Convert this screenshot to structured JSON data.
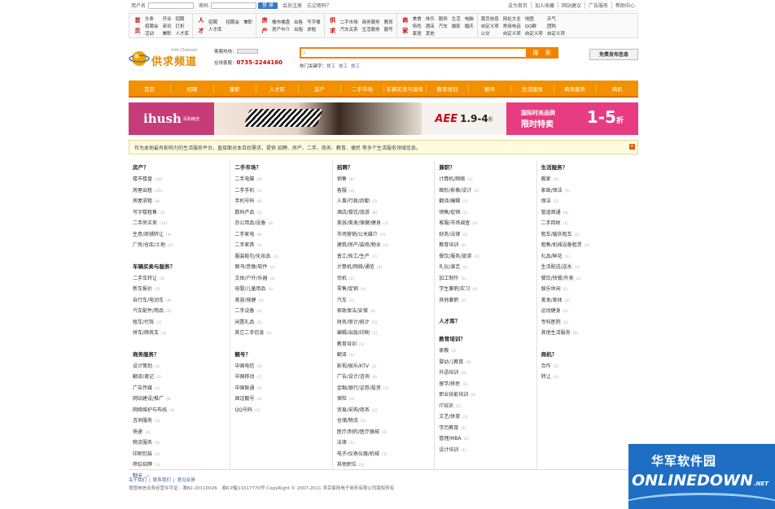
{
  "topbar": {
    "user_label": "用户名",
    "pwd_label": "密码",
    "login": "登 录",
    "register": "会员注册",
    "forgot": "忘记密码？",
    "right": [
      "设为首页",
      "加入收藏",
      "网站建议",
      "广告服务",
      "帮助中心"
    ]
  },
  "cat_groups": [
    {
      "title": [
        "首",
        "页"
      ],
      "cols": 3,
      "links": [
        "头条",
        "开业",
        "招聘",
        "招聘会",
        "商讯",
        "打折",
        "活动",
        "兼职",
        "人才库"
      ]
    },
    {
      "title": [
        "人",
        "才"
      ],
      "cols": 3,
      "links": [
        "招聘",
        "招聘会",
        "兼职",
        "人才库"
      ]
    },
    {
      "title": [
        "房",
        "产"
      ],
      "cols": 3,
      "links": [
        "楼市楼盘",
        "出售",
        "写字楼",
        "房产中介",
        "出租",
        "求租"
      ]
    },
    {
      "title": [
        "供",
        "求"
      ],
      "cols": 3,
      "links": [
        "二手市场",
        "商务服务",
        "教育",
        "汽车买卖",
        "生活服务",
        "靓号"
      ]
    },
    {
      "title": [
        "商",
        "家"
      ],
      "cols": 5,
      "links": [
        "美食",
        "休乐",
        "服饰",
        "生活",
        "电脑",
        "特色",
        "酒店",
        "汽车",
        "摄影",
        "婚庆",
        "家居",
        "其他"
      ]
    },
    {
      "title": [
        "",
        ""
      ],
      "cols": 4,
      "links": [
        "黄页信息",
        "网址大全",
        "地图",
        "天气",
        "自定义项",
        "常用电话",
        "QQ群",
        "团购",
        "公交",
        "自定义项",
        "自定义项",
        "自定义项"
      ]
    }
  ],
  "header": {
    "logo_en": "Info Channel",
    "logo_cn": "供求频道",
    "hotline_label": "客服热线：",
    "online_label": "在线客服：",
    "phone": "0735-2244160",
    "search_btn": "搜 索",
    "hot_label": "热门关键字：",
    "hot_words": [
      "技工",
      "技工",
      "技工"
    ],
    "publish": "免费发布信息"
  },
  "nav": [
    "首页",
    "招聘",
    "兼职",
    "人才库",
    "房产",
    "二手市场",
    "车辆买卖与服务",
    "教育培训",
    "靓号",
    "生活服务",
    "商务服务",
    "商机"
  ],
  "banner": {
    "b1": "ihush",
    "b1_small": "百购精选",
    "b3_brand": "AEE",
    "b3_disc": "1.9-4",
    "b3_unit": "折",
    "b4_line1": "国际时尚品牌",
    "b4_line2": "限时特卖",
    "b4_big": "1-5",
    "b4_unit": "折"
  },
  "notice": "作为本地最有影响力的生活服务平台，直接面对本百姓需求，提供 招聘、房产、二手、商务、教育、便民 等多个生活服务领域信息。",
  "columns": [
    [
      {
        "title": "房产？",
        "items": [
          [
            "楼市楼盘",
            "10"
          ],
          [
            "房屋出租",
            "25"
          ],
          [
            "房屋求租",
            "8"
          ],
          [
            "写字楼租售",
            "3"
          ],
          [
            "二手房买卖",
            "12"
          ],
          [
            "生意/商铺转让",
            "4"
          ],
          [
            "厂房/仓库/土地",
            "2"
          ]
        ]
      },
      {
        "title": "车辆买卖与服务？",
        "items": [
          [
            "二手车转让",
            "5"
          ],
          [
            "新车报价",
            "3"
          ],
          [
            "自行车/电动车",
            "6"
          ],
          [
            "汽车配件/用品",
            "2"
          ],
          [
            "租车/代驾",
            "1"
          ],
          [
            "拼车/顺风车",
            "3"
          ]
        ]
      },
      {
        "title": "商务服务？",
        "items": [
          [
            "设计策划",
            "4"
          ],
          [
            "翻译/速记",
            "1"
          ],
          [
            "广告传媒",
            "2"
          ],
          [
            "网站建设/推广",
            "6"
          ],
          [
            "网络维护与布线",
            "3"
          ],
          [
            "咨询服务",
            "1"
          ],
          [
            "快递",
            "2"
          ],
          [
            "物流服务",
            "5"
          ],
          [
            "印刷包装",
            "3"
          ],
          [
            "喷绘招牌",
            "1"
          ],
          [
            "制卡",
            "2"
          ]
        ]
      }
    ],
    [
      {
        "title": "二手市场？",
        "items": [
          [
            "二手电脑",
            "3"
          ],
          [
            "二手手机",
            "5"
          ],
          [
            "手机号码",
            "8"
          ],
          [
            "数码产品",
            "2"
          ],
          [
            "办公用品/设备",
            "4"
          ],
          [
            "二手家电",
            "6"
          ],
          [
            "二手家具",
            "3"
          ],
          [
            "服装鞋包/化妆品",
            "1"
          ],
          [
            "图书/音像/软件",
            "2"
          ],
          [
            "文体/户外/乐器",
            "4"
          ],
          [
            "母婴/儿童用品",
            "1"
          ],
          [
            "美容/保健",
            "3"
          ],
          [
            "二手设备",
            "2"
          ],
          [
            "闲置礼品",
            "5"
          ],
          [
            "其它二手信息",
            "1"
          ]
        ]
      },
      {
        "title": "靓号？",
        "items": [
          [
            "中国电信",
            "4"
          ],
          [
            "中国移动",
            "7"
          ],
          [
            "中国联通",
            "3"
          ],
          [
            "固话靓号",
            "2"
          ],
          [
            "QQ号码",
            "1"
          ]
        ]
      }
    ],
    [
      {
        "title": "招聘？",
        "items": [
          [
            "销售",
            "6"
          ],
          [
            "客服",
            "4"
          ],
          [
            "人事/行政/后勤",
            "3"
          ],
          [
            "酒店/餐饮/旅游",
            "8"
          ],
          [
            "美容/美发/保健/健身",
            "2"
          ],
          [
            "市场营销/公关媒介",
            "5"
          ],
          [
            "建筑/房产/装修/物业",
            "3"
          ],
          [
            "普工/技工/生产",
            "7"
          ],
          [
            "计算机/网络/通信",
            "4"
          ],
          [
            "司机",
            "2"
          ],
          [
            "零售/促销",
            "3"
          ],
          [
            "汽车",
            "1"
          ],
          [
            "家政保洁/安保",
            "4"
          ],
          [
            "财务/审计/统计",
            "2"
          ],
          [
            "编辑/出版/印刷",
            "1"
          ],
          [
            "教育培训",
            "3"
          ],
          [
            "翻译",
            "1"
          ],
          [
            "影视/娱乐/KTV",
            "2"
          ],
          [
            "广告/设计/咨询",
            "4"
          ],
          [
            "金融/银行/证券/投资",
            "1"
          ],
          [
            "保险",
            "3"
          ],
          [
            "贸易/采购/商务",
            "2"
          ],
          [
            "仓储/物流",
            "5"
          ],
          [
            "医疗/制药/医疗器械",
            "2"
          ],
          [
            "法律",
            "1"
          ],
          [
            "电子/仪表仪器/机械",
            "3"
          ],
          [
            "其他职位",
            "4"
          ]
        ]
      }
    ],
    [
      {
        "title": "兼职？",
        "items": [
          [
            "计算机/网络",
            "3"
          ],
          [
            "图形/影像/设计",
            "2"
          ],
          [
            "翻译/编辑",
            "1"
          ],
          [
            "销售/促销",
            "5"
          ],
          [
            "客服/市场调查",
            "2"
          ],
          [
            "财务/法律",
            "1"
          ],
          [
            "教育培训",
            "4"
          ],
          [
            "餐饮/服务/旅游",
            "3"
          ],
          [
            "礼仪/演艺",
            "2"
          ],
          [
            "加工制作",
            "1"
          ],
          [
            "学生兼职/实习",
            "6"
          ],
          [
            "其他兼职",
            "2"
          ]
        ]
      },
      {
        "title": "人才库？",
        "items": []
      },
      {
        "title": "教育培训？",
        "items": [
          [
            "家教",
            "5"
          ],
          [
            "婴幼儿教育",
            "2"
          ],
          [
            "外语培训",
            "3"
          ],
          [
            "留学/移民",
            "1"
          ],
          [
            "职业技能培训",
            "4"
          ],
          [
            "IT培训",
            "2"
          ],
          [
            "文艺/体育",
            "3"
          ],
          [
            "学历教育",
            "1"
          ],
          [
            "管理/MBA",
            "2"
          ],
          [
            "设计培训",
            "1"
          ]
        ]
      }
    ],
    [
      {
        "title": "生活服务？",
        "items": [
          [
            "搬家",
            "3"
          ],
          [
            "家政/保洁",
            "5"
          ],
          [
            "保洁",
            "2"
          ],
          [
            "管道疏通",
            "4"
          ],
          [
            "二手回收",
            "1"
          ],
          [
            "租车/婚庆租车",
            "2"
          ],
          [
            "租售/机械设备租赁",
            "3"
          ],
          [
            "礼品/鲜花",
            "1"
          ],
          [
            "生活配送/送水",
            "4"
          ],
          [
            "餐饮/快餐/外卖",
            "2"
          ],
          [
            "娱乐休闲",
            "1"
          ],
          [
            "美发/美体",
            "3"
          ],
          [
            "运动健身",
            "2"
          ],
          [
            "专科医院",
            "1"
          ],
          [
            "其他生活服务",
            "4"
          ]
        ]
      },
      {
        "title": "商机？",
        "items": [
          [
            "合作",
            "2"
          ],
          [
            "转让",
            "1"
          ]
        ]
      }
    ]
  ],
  "footer": {
    "links": [
      "关于我们",
      "联系我们",
      "意见反馈"
    ],
    "copy": "增值电信业务经营许可证：湘B2-20110026　湘ICP备11017770号 CopyRight © 2007-2011 寻百家网电子商务有限公司版权所有"
  },
  "watermark": {
    "cn": "华军软件园",
    "en_a": "ONLINEDOWN",
    "en_b": "",
    "net": ".NET"
  }
}
